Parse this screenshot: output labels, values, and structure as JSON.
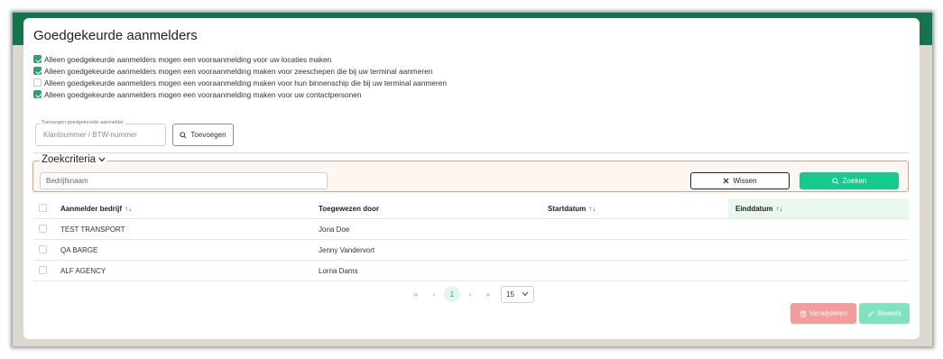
{
  "page": {
    "title": "Goedgekeurde aanmelders"
  },
  "options": [
    {
      "label": "Alleen goedgekeurde aanmelders mogen een vooraanmelding voor uw locaties maken",
      "checked": true
    },
    {
      "label": "Alleen goedgekeurde aanmelders mogen een vooraanmelding maken voor zeeschepen die bij uw terminal aanmeren",
      "checked": true
    },
    {
      "label": "Alleen goedgekeurde aanmelders mogen een vooraanmelding maken voor hun binnenschip die bij uw terminal aanmeren",
      "checked": false
    },
    {
      "label": "Alleen goedgekeurde aanmelders mogen een vooraanmelding maken voor uw contactpersonen",
      "checked": true
    }
  ],
  "add": {
    "legend": "Toevoegen goedgekeurde aanmelder",
    "placeholder": "Klantnummer / BTW-nummer",
    "button": "Toevoegen"
  },
  "search": {
    "title": "Zoekcriteria",
    "placeholder": "Bedrijfsnaam",
    "clear": "Wissen",
    "submit": "Zoeken"
  },
  "table": {
    "columns": {
      "company": "Aanmelder bedrijf",
      "assigned": "Toegewezen door",
      "start": "Startdatum",
      "end": "Einddatum"
    },
    "rows": [
      {
        "company": "TEST TRANSPORT",
        "assigned": "Jona Doe",
        "start": "",
        "end": ""
      },
      {
        "company": "QA BARGE",
        "assigned": "Jenny Vandervort",
        "start": "",
        "end": ""
      },
      {
        "company": "ALF AGENCY",
        "assigned": "Lorna Dams",
        "start": "",
        "end": ""
      }
    ]
  },
  "pagination": {
    "first": "«",
    "prev": "‹",
    "current": "1",
    "next": "›",
    "last": "»",
    "page_size": "15"
  },
  "actions": {
    "delete": "Verwijderen",
    "edit": "Bewerk"
  },
  "colors": {
    "brand_dark": "#13744e",
    "accent": "#16c98d",
    "checked": "#2aa36b",
    "delete": "#f39c9c",
    "edit": "#7fe3bd"
  }
}
